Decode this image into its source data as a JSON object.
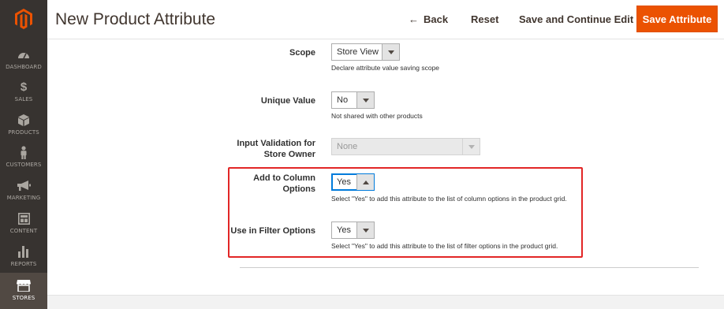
{
  "sidebar": {
    "items": [
      {
        "label": "DASHBOARD",
        "icon": "speedometer-icon"
      },
      {
        "label": "SALES",
        "icon": "dollar-icon"
      },
      {
        "label": "PRODUCTS",
        "icon": "cube-icon"
      },
      {
        "label": "CUSTOMERS",
        "icon": "person-icon"
      },
      {
        "label": "MARKETING",
        "icon": "megaphone-icon"
      },
      {
        "label": "CONTENT",
        "icon": "layout-icon"
      },
      {
        "label": "REPORTS",
        "icon": "bar-chart-icon"
      },
      {
        "label": "STORES",
        "icon": "store-icon"
      }
    ]
  },
  "header": {
    "title": "New Product Attribute",
    "back_label": "Back",
    "reset_label": "Reset",
    "save_continue_label": "Save and Continue Edit",
    "save_label": "Save Attribute"
  },
  "form": {
    "scope": {
      "label": "Scope",
      "value": "Store View",
      "note": "Declare attribute value saving scope"
    },
    "unique": {
      "label": "Unique Value",
      "value": "No",
      "note": "Not shared with other products"
    },
    "validation": {
      "label_line1": "Input Validation for",
      "label_line2": "Store Owner",
      "value": "None"
    },
    "column": {
      "label_line1": "Add to Column",
      "label_line2": "Options",
      "value": "Yes",
      "note": "Select \"Yes\" to add this attribute to the list of column options in the product grid."
    },
    "filter": {
      "label": "Use in Filter Options",
      "value": "Yes",
      "note": "Select \"Yes\" to add this attribute to the list of filter options in the product grid."
    }
  },
  "colors": {
    "accent": "#eb5202",
    "sidebar": "#373330",
    "highlight": "#e22626"
  }
}
